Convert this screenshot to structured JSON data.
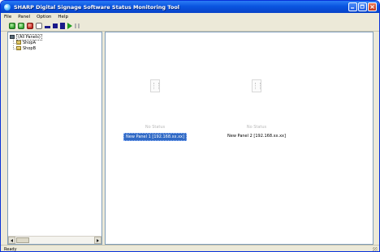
{
  "window": {
    "title": "SHARP Digital Signage Software Status Monitoring Tool",
    "controls": [
      "minimize",
      "maximize",
      "close"
    ]
  },
  "menu": [
    "File",
    "Panel",
    "Option",
    "Help"
  ],
  "toolbar": {
    "tools": [
      "connect-green-icon",
      "connect-green-icon",
      "disconnect-red-icon",
      "properties-icon",
      "line-icon",
      "square-icon",
      "tall-square-icon",
      "play-icon",
      "pause-icon"
    ]
  },
  "tree": {
    "root": "(All Panels)",
    "children": [
      "ShopA",
      "ShopB"
    ]
  },
  "panels": [
    {
      "status": "No Status",
      "name": "New Panel 1 [192.168.xx.xx]",
      "selected": true
    },
    {
      "status": "No Status",
      "name": "New Panel 2 [192.168.xx.xx]",
      "selected": false
    }
  ],
  "statusbar": {
    "text": "Ready"
  },
  "colors": {
    "title_bar": "#0a55e0",
    "selection": "#316ac5"
  }
}
